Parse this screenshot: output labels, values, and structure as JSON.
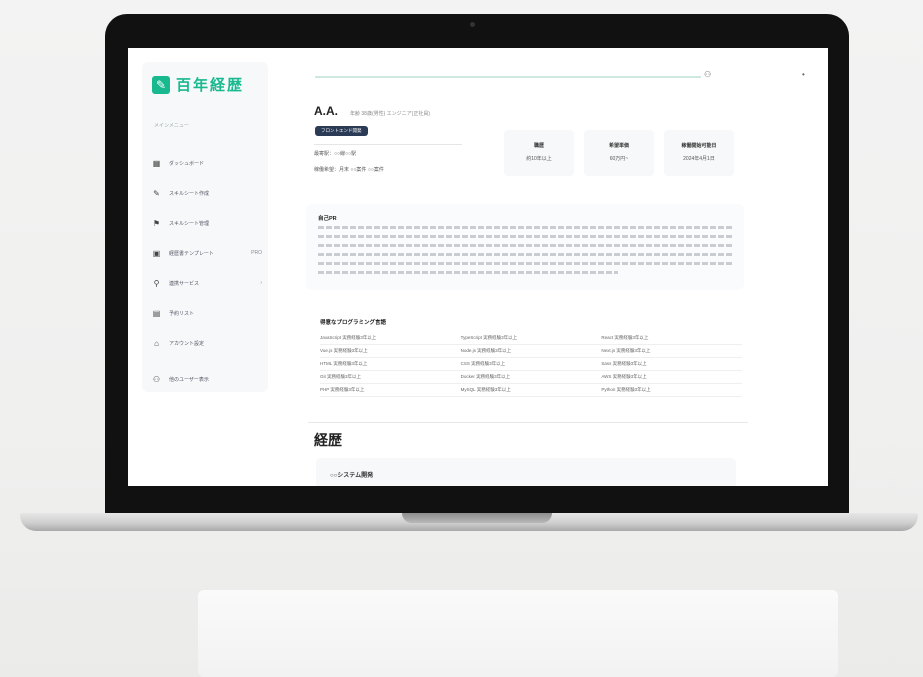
{
  "brand": {
    "name": "百年経歴",
    "color": "#18b98f"
  },
  "sidebar": {
    "menu_label": "メインメニュー",
    "items": [
      {
        "icon": "grid-icon",
        "label": "ダッシュボード"
      },
      {
        "icon": "pencil-icon",
        "label": "スキルシート作成"
      },
      {
        "icon": "flag-icon",
        "label": "スキルシート管理"
      },
      {
        "icon": "folder-icon",
        "label": "経歴書テンプレート",
        "badge": "PRO"
      },
      {
        "icon": "link-icon",
        "label": "連携サービス",
        "badge": "›"
      },
      {
        "icon": "calendar-icon",
        "label": "予約リスト"
      },
      {
        "icon": "lock-icon",
        "label": "アカウント設定"
      },
      {
        "icon": "person-icon",
        "label": "他のユーザー表示"
      }
    ]
  },
  "profile": {
    "name": "A.A.",
    "subtitle": "年齢 38歳(男性)  エンジニア(正社員)",
    "tag": "フロントエンド開発",
    "info_line1": "最寄駅：○○線○○駅",
    "info_line2": "稼働希望：月末  ○○案件  ○○案件"
  },
  "stats": [
    {
      "label": "職歴",
      "value": "約10年以上"
    },
    {
      "label": "希望単価",
      "value": "60万円~"
    },
    {
      "label": "稼働開始可能日",
      "value": "2024年4月1日"
    }
  ],
  "summary": {
    "heading": "自己PR",
    "lines": 6
  },
  "skills": {
    "heading": "得意なプログラミング言語",
    "rows": [
      [
        "JavaScript  実務経験3年以上",
        "TypeScript  実務経験3年以上",
        "React  実務経験3年以上"
      ],
      [
        "Vue.js  実務経験3年以上",
        "Node.js  実務経験3年以上",
        "Next.js  実務経験3年以上"
      ],
      [
        "HTML  実務経験3年以上",
        "CSS  実務経験3年以上",
        "Sass  実務経験3年以上"
      ],
      [
        "Git  実務経験3年以上",
        "Docker  実務経験3年以上",
        "AWS  実務経験3年以上"
      ],
      [
        "PHP  実務経験3年以上",
        "MySQL  実務経験3年以上",
        "Python  実務経験3年以上"
      ]
    ]
  },
  "career": {
    "heading": "経歴",
    "first_item": "○○システム開発"
  }
}
